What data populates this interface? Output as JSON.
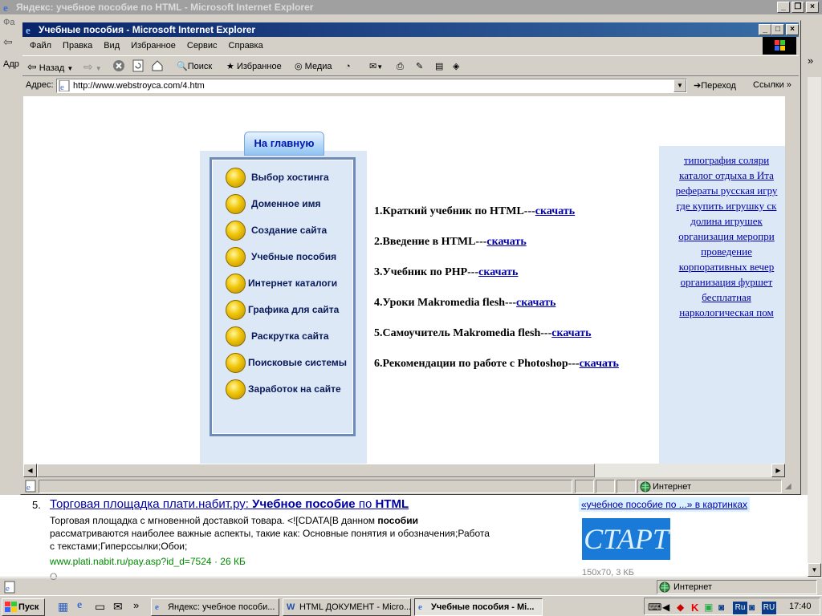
{
  "bg_window": {
    "title": "Яндекс: учебное пособие по HTML - Microsoft Internet Explorer",
    "menu_first": "Фа",
    "addr_label": "Адр",
    "result": {
      "number": "5.",
      "title_part1": "Торговая площадка плати.набит.ру: ",
      "title_bold1": "Учебное пособие",
      "title_mid": " по ",
      "title_bold2": "HTML",
      "snippet1": "Торговая площадка с мгновенной доставкой товара. <![CDATA[В данном ",
      "snippet_bold": "пособии",
      "snippet2": "рассматриваются наиболее важные аспекты, такие как: Основные понятия и обозначения;Работа",
      "snippet3": "с текстами;Гиперссылки;Обои;",
      "url": "www.plati.nabit.ru/pay.asp?id_d=7524",
      "size": "· 26 КБ",
      "next_text": "О"
    },
    "images_link": "«учебное пособие по ...» в картинках",
    "image_caption": "150x70, 3 КБ",
    "start_logo": "СТАРТ",
    "status_zone": "Интернет"
  },
  "front_window": {
    "title": "Учебные пособия - Microsoft Internet Explorer",
    "menu": [
      "Файл",
      "Правка",
      "Вид",
      "Избранное",
      "Сервис",
      "Справка"
    ],
    "toolbar": {
      "back": "Назад",
      "search": "Поиск",
      "favorites": "Избранное",
      "media": "Медиа"
    },
    "address_label": "Адрес:",
    "address_url": "http://www.webstroyca.com/4.htm",
    "go_label": "Переход",
    "links_label": "Ссылки",
    "status_zone": "Интернет"
  },
  "page": {
    "home_tab": "На главную",
    "nav": [
      "Выбор хостинга",
      "Доменное имя",
      "Создание сайта",
      "Учебные пособия",
      "Интернет каталоги",
      "Графика для сайта",
      "Раскрутка сайта",
      "Поисковые системы",
      "Заработок на сайте"
    ],
    "downloads": [
      {
        "text": "1.Краткий учебник по HTML---",
        "link": "скачать"
      },
      {
        "text": "2.Введение в HTML---",
        "link": "скачать"
      },
      {
        "text": "3.Учебник по PHP---",
        "link": "скачать"
      },
      {
        "text": "4.Уроки Makromedia flesh---",
        "link": "скачать"
      },
      {
        "text": "5.Самоучитель Makromedia flesh---",
        "link": "скачать"
      },
      {
        "text": "6.Рекомендации по работе с Photoshop---",
        "link": "скачать"
      }
    ],
    "ads": [
      "типография соляри",
      "каталог отдыха в Ита",
      "рефераты русская игру",
      "где купить игрушку ск",
      "долина игрушек",
      "организация меропри",
      "проведение",
      "корпоративных вечер",
      "организация фуршет",
      "бесплатная",
      "наркологическая пом"
    ]
  },
  "taskbar": {
    "start": "Пуск",
    "tasks": [
      "Яндекс: учебное пособи...",
      "HTML ДОКУМЕНТ - Micro...",
      "Учебные пособия - Mi..."
    ],
    "lang1": "Ru",
    "lang2": "RU",
    "clock": "17:40"
  },
  "colors": {
    "link": "#0000aa",
    "nav_panel": "#dce8f5",
    "titlebar_active": "#0a246a"
  }
}
